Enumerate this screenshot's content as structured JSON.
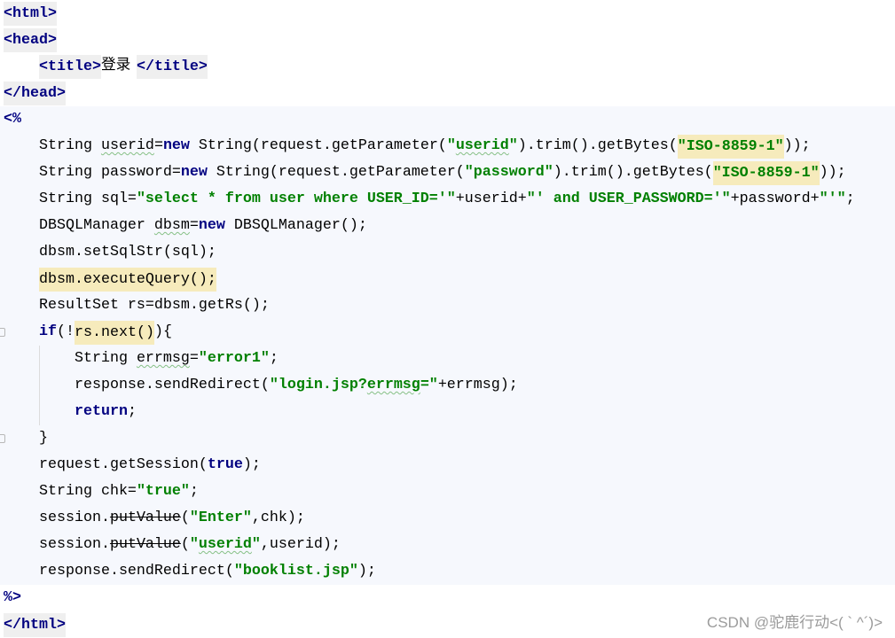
{
  "editor": {
    "lines": [
      {
        "tokens": [
          {
            "t": "<html>",
            "color": "#000080",
            "bg": "#efefef"
          }
        ]
      },
      {
        "tokens": [
          {
            "t": "<head>",
            "color": "#000080",
            "bg": "#efefef"
          }
        ]
      },
      {
        "tokens": [
          {
            "t": "    "
          },
          {
            "t": "<title>",
            "color": "#000080",
            "bg": "#efefef"
          },
          {
            "t": "登录"
          },
          {
            "t": "</title>",
            "color": "#000080",
            "bg": "#efefef"
          }
        ]
      },
      {
        "tokens": [
          {
            "t": "</head>",
            "color": "#000080",
            "bg": "#efefef"
          }
        ]
      },
      {
        "bg": "#f6f8fd",
        "tokens": [
          {
            "t": "<%",
            "color": "#000080"
          }
        ]
      },
      {
        "bg": "#f6f8fd",
        "tokens": [
          {
            "t": "    String "
          },
          {
            "t": "userid",
            "typo": true
          },
          {
            "t": "="
          },
          {
            "t": "new",
            "color": "#000080"
          },
          {
            "t": " String(request.getParameter("
          },
          {
            "t": "\"",
            "color": "#008000"
          },
          {
            "t": "userid",
            "color": "#008000",
            "typo": true
          },
          {
            "t": "\"",
            "color": "#008000"
          },
          {
            "t": ").trim().getBytes("
          },
          {
            "t": "\"ISO-8859-1\"",
            "color": "#008000",
            "bg": "#f6ebbc"
          },
          {
            "t": "));"
          }
        ]
      },
      {
        "bg": "#f6f8fd",
        "tokens": [
          {
            "t": "    String password="
          },
          {
            "t": "new",
            "color": "#000080"
          },
          {
            "t": " String(request.getParameter("
          },
          {
            "t": "\"password\"",
            "color": "#008000"
          },
          {
            "t": ").trim().getBytes("
          },
          {
            "t": "\"ISO-8859-1\"",
            "color": "#008000",
            "bg": "#f6ebbc"
          },
          {
            "t": "));"
          }
        ]
      },
      {
        "bg": "#f6f8fd",
        "tokens": [
          {
            "t": "    String sql="
          },
          {
            "t": "\"select * from user where USER_ID='\"",
            "color": "#008000"
          },
          {
            "t": "+userid+"
          },
          {
            "t": "\"' and USER_PASSWORD='\"",
            "color": "#008000"
          },
          {
            "t": "+password+"
          },
          {
            "t": "\"'\"",
            "color": "#008000"
          },
          {
            "t": ";"
          }
        ]
      },
      {
        "bg": "#f6f8fd",
        "tokens": [
          {
            "t": "    DBSQLManager "
          },
          {
            "t": "dbsm",
            "typo": true
          },
          {
            "t": "="
          },
          {
            "t": "new",
            "color": "#000080"
          },
          {
            "t": " DBSQLManager();"
          }
        ]
      },
      {
        "bg": "#f6f8fd",
        "tokens": [
          {
            "t": "    dbsm.setSqlStr(sql);"
          }
        ]
      },
      {
        "bg": "#f6f8fd",
        "tokens": [
          {
            "t": "    "
          },
          {
            "t": "dbsm.executeQuery();",
            "bg": "#f6ebbc"
          }
        ]
      },
      {
        "bg": "#f6f8fd",
        "tokens": [
          {
            "t": "    ResultSet rs=dbsm.getRs();"
          }
        ]
      },
      {
        "bg": "#f6f8fd",
        "gutter_icon": "fold-icon",
        "tokens": [
          {
            "t": "    "
          },
          {
            "t": "if",
            "color": "#000080"
          },
          {
            "t": "(!"
          },
          {
            "t": "rs.next()",
            "bg": "#f6ebbc"
          },
          {
            "t": "){"
          }
        ]
      },
      {
        "bg": "#f6f8fd",
        "tokens": [
          {
            "t": "        String "
          },
          {
            "t": "errmsg",
            "typo": true
          },
          {
            "t": "="
          },
          {
            "t": "\"error1\"",
            "color": "#008000"
          },
          {
            "t": ";"
          }
        ]
      },
      {
        "bg": "#f6f8fd",
        "tokens": [
          {
            "t": "        response.sendRedirect("
          },
          {
            "t": "\"login.jsp?",
            "color": "#008000"
          },
          {
            "t": "errmsg",
            "color": "#008000",
            "typo": true
          },
          {
            "t": "=\"",
            "color": "#008000"
          },
          {
            "t": "+errmsg);"
          }
        ]
      },
      {
        "bg": "#f6f8fd",
        "tokens": [
          {
            "t": "        "
          },
          {
            "t": "return",
            "color": "#000080"
          },
          {
            "t": ";"
          }
        ]
      },
      {
        "bg": "#f6f8fd",
        "gutter_icon": "fold-icon",
        "tokens": [
          {
            "t": "    }"
          }
        ]
      },
      {
        "bg": "#f6f8fd",
        "tokens": [
          {
            "t": "    request.getSession("
          },
          {
            "t": "true",
            "color": "#000080"
          },
          {
            "t": ");"
          }
        ]
      },
      {
        "bg": "#f6f8fd",
        "tokens": [
          {
            "t": "    String chk="
          },
          {
            "t": "\"true\"",
            "color": "#008000"
          },
          {
            "t": ";"
          }
        ]
      },
      {
        "bg": "#f6f8fd",
        "tokens": [
          {
            "t": "    session."
          },
          {
            "t": "putValue",
            "strike": true
          },
          {
            "t": "("
          },
          {
            "t": "\"Enter\"",
            "color": "#008000"
          },
          {
            "t": ",chk);"
          }
        ]
      },
      {
        "bg": "#f6f8fd",
        "tokens": [
          {
            "t": "    session."
          },
          {
            "t": "putValue",
            "strike": true
          },
          {
            "t": "("
          },
          {
            "t": "\"",
            "color": "#008000"
          },
          {
            "t": "userid",
            "color": "#008000",
            "typo": true
          },
          {
            "t": "\"",
            "color": "#008000"
          },
          {
            "t": ",userid);"
          }
        ]
      },
      {
        "bg": "#f6f8fd",
        "tokens": [
          {
            "t": "    response.sendRedirect("
          },
          {
            "t": "\"booklist.jsp\"",
            "color": "#008000"
          },
          {
            "t": ");"
          }
        ]
      },
      {
        "tokens": [
          {
            "t": "%>",
            "color": "#000080"
          }
        ]
      },
      {
        "tokens": [
          {
            "t": "</html>",
            "color": "#000080",
            "bg": "#efefef"
          }
        ]
      }
    ]
  },
  "watermark": "CSDN @驼鹿行动<( ` ^´)>"
}
